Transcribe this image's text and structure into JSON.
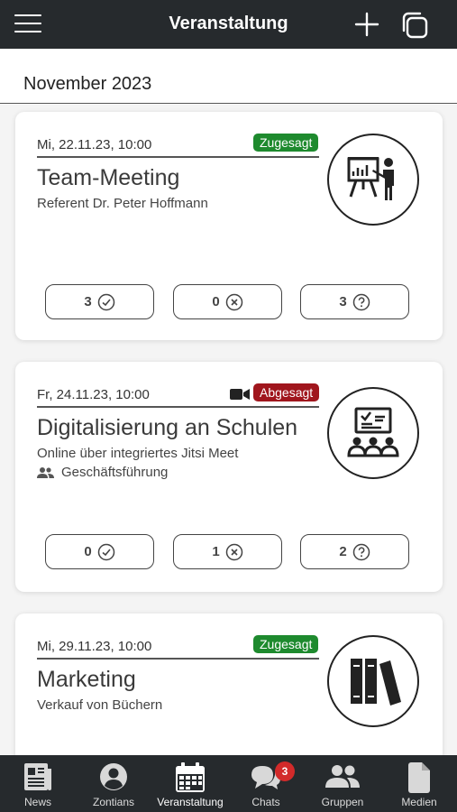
{
  "header": {
    "title": "Veranstaltung"
  },
  "month": "November 2023",
  "events": [
    {
      "date": "Mi, 22.11.23, 10:00",
      "status": "Zugesagt",
      "status_color": "#1e8a2e",
      "title": "Team-Meeting",
      "subtitle": "Referent Dr. Peter Hoffmann",
      "icon": "presenter-board-icon",
      "counts": {
        "accepted": "3",
        "declined": "0",
        "open": "3"
      }
    },
    {
      "date": "Fr, 24.11.23, 10:00",
      "status": "Abgesagt",
      "status_color": "#a0161d",
      "title": "Digitalisierung an Schulen",
      "subtitle": "Online über integriertes Jitsi Meet",
      "group": "Geschäftsführung",
      "icon": "audience-screen-icon",
      "counts": {
        "accepted": "0",
        "declined": "1",
        "open": "2"
      }
    },
    {
      "date": "Mi, 29.11.23, 10:00",
      "status": "Zugesagt",
      "status_color": "#1e8a2e",
      "title": "Marketing",
      "subtitle": "Verkauf von Büchern",
      "icon": "books-icon"
    }
  ],
  "nav": {
    "items": [
      {
        "label": "News",
        "icon": "newspaper-icon"
      },
      {
        "label": "Zontians",
        "icon": "user-circle-icon"
      },
      {
        "label": "Veranstaltung",
        "icon": "calendar-icon"
      },
      {
        "label": "Chats",
        "icon": "chat-bubbles-icon"
      },
      {
        "label": "Gruppen",
        "icon": "group-icon"
      },
      {
        "label": "Medien",
        "icon": "file-icon"
      }
    ],
    "chats_badge": "3"
  },
  "colors": {
    "bar": "#262a2d",
    "accepted": "#1e8a2e",
    "declined": "#a0161d",
    "badge": "#d22a2a"
  }
}
